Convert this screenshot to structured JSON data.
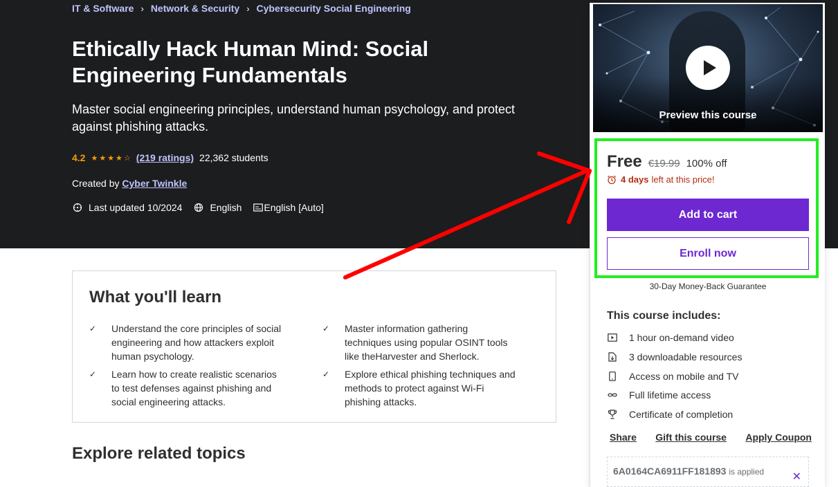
{
  "breadcrumb": [
    "IT & Software",
    "Network & Security",
    "Cybersecurity Social Engineering"
  ],
  "course": {
    "title": "Ethically Hack Human Mind: Social Engineering Fundamentals",
    "subtitle": "Master social engineering principles, understand human psychology, and protect against phishing attacks.",
    "rating": "4.2",
    "ratings_count": "(219 ratings)",
    "students": "22,362 students",
    "created_by_label": "Created by",
    "instructor": "Cyber Twinkle",
    "last_updated": "Last updated 10/2024",
    "language": "English",
    "captions": "English [Auto]"
  },
  "learn": {
    "title": "What you'll learn",
    "items": [
      "Understand the core principles of social engineering and how attackers exploit human psychology.",
      "Master information gathering techniques using popular OSINT tools like theHarvester and Sherlock.",
      "Learn how to create realistic scenarios to test defenses against phishing and social engineering attacks.",
      "Explore ethical phishing techniques and methods to protect against Wi-Fi phishing attacks."
    ]
  },
  "related_title": "Explore related topics",
  "sidebar": {
    "preview_label": "Preview this course",
    "price_free": "Free",
    "price_original": "€19.99",
    "discount": "100% off",
    "urgency_days": "4 days",
    "urgency_rest": "left at this price!",
    "add_to_cart": "Add to cart",
    "enroll_now": "Enroll now",
    "guarantee": "30-Day Money-Back Guarantee",
    "includes_title": "This course includes:",
    "includes": [
      {
        "icon": "video-icon",
        "label": "1 hour on-demand video"
      },
      {
        "icon": "download-file-icon",
        "label": "3 downloadable resources"
      },
      {
        "icon": "mobile-icon",
        "label": "Access on mobile and TV"
      },
      {
        "icon": "infinity-icon",
        "label": "Full lifetime access"
      },
      {
        "icon": "trophy-icon",
        "label": "Certificate of completion"
      }
    ],
    "share": "Share",
    "gift": "Gift this course",
    "apply_coupon": "Apply Coupon",
    "coupon_code": "6A0164CA6911FF181893",
    "coupon_applied": "is applied"
  },
  "colors": {
    "hero_bg": "#1c1d1f",
    "accent_purple": "#6d28d2",
    "link_lavender": "#c0c4fc",
    "star_orange": "#f69c08",
    "urgency_red": "#b32d0f",
    "highlight_green": "#22ee22",
    "annotation_arrow": "#ff0000"
  }
}
